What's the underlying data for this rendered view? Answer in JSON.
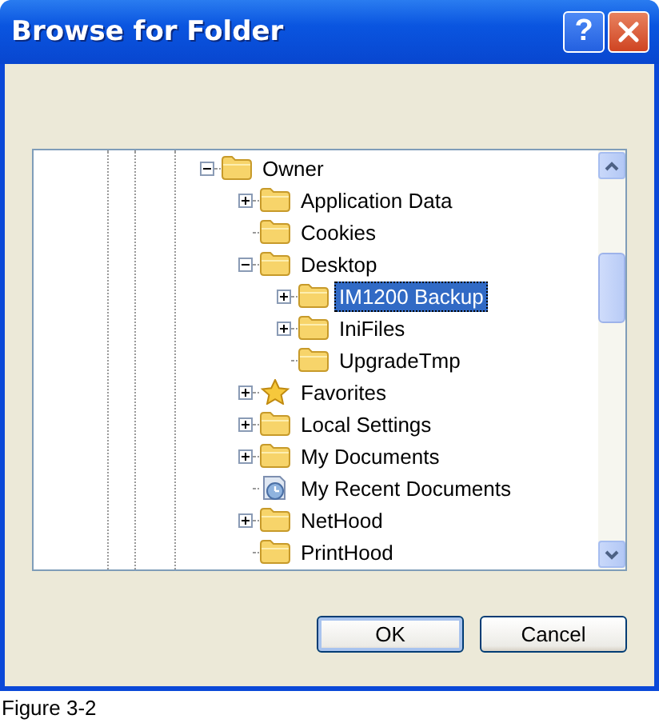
{
  "window": {
    "title": "Browse for Folder",
    "help_button": "?"
  },
  "tree": {
    "items": [
      {
        "label": "Owner",
        "kind": "folder",
        "expanded": true,
        "selected": false,
        "children": [
          {
            "label": "Application Data",
            "kind": "folder",
            "expanded": false,
            "selected": false
          },
          {
            "label": "Cookies",
            "kind": "folder",
            "selected": false
          },
          {
            "label": "Desktop",
            "kind": "folder",
            "expanded": true,
            "selected": false,
            "children": [
              {
                "label": "IM1200 Backup",
                "kind": "folder",
                "expanded": false,
                "selected": true
              },
              {
                "label": "IniFiles",
                "kind": "folder",
                "expanded": false,
                "selected": false
              },
              {
                "label": "UpgradeTmp",
                "kind": "folder",
                "selected": false
              }
            ]
          },
          {
            "label": "Favorites",
            "kind": "star",
            "expanded": false,
            "selected": false
          },
          {
            "label": "Local Settings",
            "kind": "folder",
            "expanded": false,
            "selected": false
          },
          {
            "label": "My Documents",
            "kind": "folder",
            "expanded": false,
            "selected": false
          },
          {
            "label": "My Recent Documents",
            "kind": "recent",
            "selected": false
          },
          {
            "label": "NetHood",
            "kind": "folder",
            "expanded": false,
            "selected": false
          },
          {
            "label": "PrintHood",
            "kind": "folder",
            "selected": false
          }
        ]
      }
    ]
  },
  "buttons": [
    "OK",
    "Cancel"
  ],
  "caption": "Figure 3-2"
}
